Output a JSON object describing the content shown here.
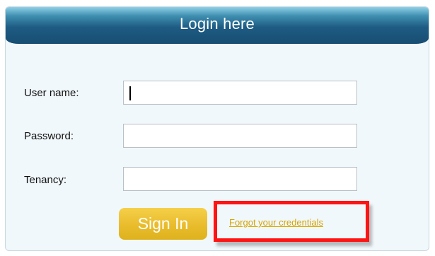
{
  "header": {
    "title": "Login here"
  },
  "form": {
    "username_label": "User name:",
    "username_value": "",
    "password_label": "Password:",
    "password_value": "",
    "tenancy_label": "Tenancy:",
    "tenancy_value": ""
  },
  "actions": {
    "sign_in_label": "Sign In",
    "forgot_label": "Forgot your credentials"
  },
  "colors": {
    "header_dark": "#1e5b83",
    "header_light": "#8fd1e6",
    "panel_background": "#f1f8fb",
    "button_yellow": "#e9bc2c",
    "link_yellow": "#d6a300",
    "highlight_red": "#ff1414"
  },
  "annotation": {
    "highlight": "red rectangle around forgot credentials link"
  }
}
